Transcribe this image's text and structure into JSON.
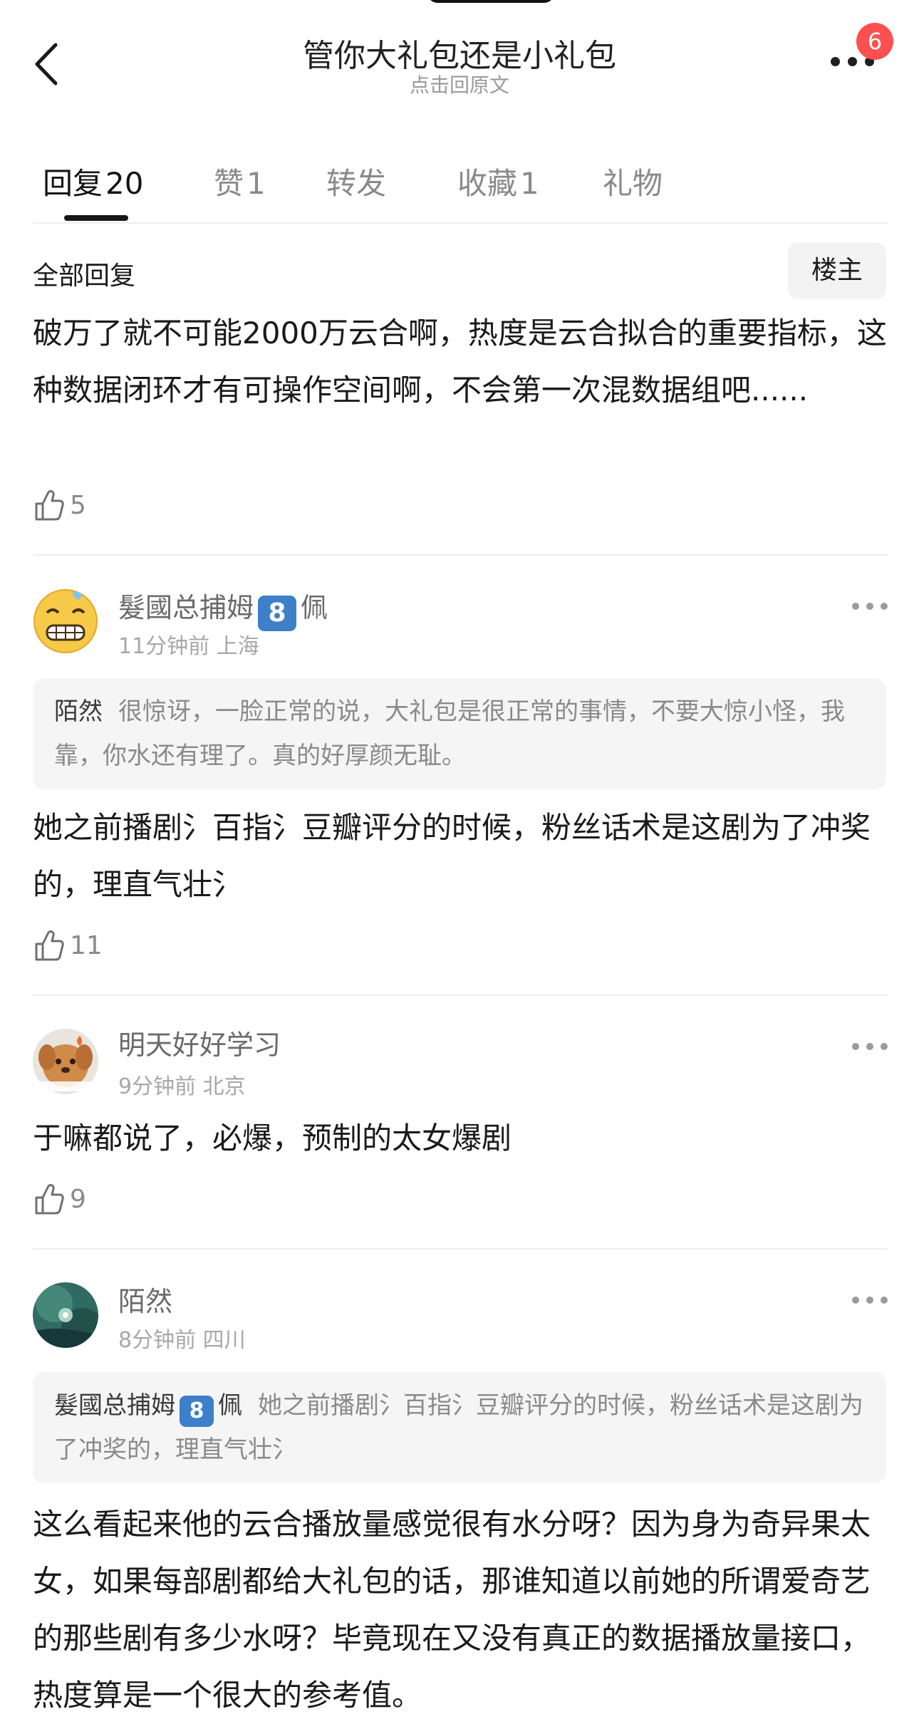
{
  "header": {
    "title": "管你大礼包还是小礼包",
    "subtitle": "点击回原文",
    "notification_count": "6"
  },
  "tabs": [
    {
      "label": "回复",
      "count": "20",
      "active": true
    },
    {
      "label": "赞",
      "count": "1"
    },
    {
      "label": "转发",
      "count": ""
    },
    {
      "label": "收藏",
      "count": "1"
    },
    {
      "label": "礼物",
      "count": ""
    }
  ],
  "section": {
    "title": "全部回复",
    "owner_button": "楼主"
  },
  "original_post": {
    "text": "破万了就不可能2000万云合啊，热度是云合拟合的重要指标，这种数据闭环才有可操作空间啊，不会第一次混数据组吧......",
    "likes": "5"
  },
  "comments": [
    {
      "username": "髮國总捕姆",
      "level": "8",
      "suffix": "佩",
      "time": "11分钟前",
      "location": "上海",
      "quote": {
        "name": "陌然",
        "text": "很惊讶，一脸正常的说，大礼包是很正常的事情，不要大惊小怪，我靠，你水还有理了。真的好厚颜无耻。"
      },
      "text": "她之前播剧氵百指氵豆瓣评分的时候，粉丝话术是这剧为了冲奖的，理直气壮氵",
      "likes": "11",
      "avatar": "grimace-emoji"
    },
    {
      "username": "明天好好学习",
      "time": "9分钟前",
      "location": "北京",
      "text": "于嘛都说了，必爆，预制的太女爆剧",
      "likes": "9",
      "avatar": "toy-dog-photo"
    },
    {
      "username": "陌然",
      "time": "8分钟前",
      "location": "四川",
      "quote": {
        "name": "髮國总捕姆",
        "level": "8",
        "suffix": "佩",
        "text": "她之前播剧氵百指氵豆瓣评分的时候，粉丝话术是这剧为了冲奖的，理直气壮氵"
      },
      "text": "这么看起来他的云合播放量感觉很有水分呀？因为身为奇异果太女，如果每部剧都给大礼包的话，那谁知道以前她的所谓爱奇艺的那些剧有多少水呀？毕竟现在又没有真正的数据播放量接口，热度算是一个很大的参考值。",
      "avatar": "teal-scenery-photo"
    }
  ],
  "colors": {
    "level_badge": "#3d7fc9",
    "notification_badge": "#fb5050",
    "quote_background": "#f5f5f5"
  }
}
